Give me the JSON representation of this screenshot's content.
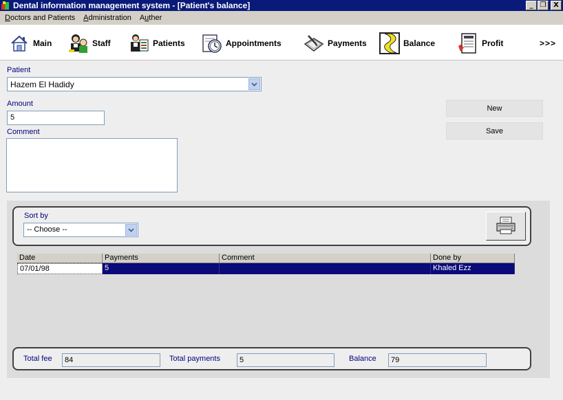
{
  "window": {
    "title": "Dental information management system - [Patient's balance]",
    "minimize": "_",
    "restore": "❐",
    "close": "X"
  },
  "menu": {
    "items": [
      {
        "label": "Doctors and Patients",
        "hotkey": "D",
        "rest": "octors and Patients"
      },
      {
        "label": "Administration",
        "hotkey": "A",
        "rest": "dministration"
      },
      {
        "label": "Auther",
        "hotkey": "u",
        "pre": "A",
        "rest": "ther"
      }
    ]
  },
  "toolbar": {
    "items": [
      {
        "label": "Main",
        "icon": "house-icon"
      },
      {
        "label": "Staff",
        "icon": "staff-icon"
      },
      {
        "label": "Patients",
        "icon": "patients-icon"
      },
      {
        "label": "Appointments",
        "icon": "clock-icon"
      },
      {
        "label": "Payments",
        "icon": "payments-icon"
      },
      {
        "label": "Balance",
        "icon": "balance-icon"
      },
      {
        "label": "Profit",
        "icon": "profit-icon"
      }
    ],
    "more": ">>>"
  },
  "form": {
    "patient_label": "Patient",
    "patient_value": "Hazem El Hadidy",
    "amount_label": "Amount",
    "amount_value": "5",
    "comment_label": "Comment",
    "comment_value": "",
    "new_button": "New",
    "save_button": "Save"
  },
  "sort": {
    "label": "Sort by",
    "value": "-- Choose --"
  },
  "grid": {
    "columns": [
      "Date",
      "Payments",
      "Comment",
      "Done by"
    ],
    "rows": [
      {
        "date": "07/01/98",
        "payments": "5",
        "comment": "",
        "done_by": "Khaled Ezz"
      }
    ]
  },
  "totals": {
    "total_fee_label": "Total fee",
    "total_fee_value": "84",
    "total_payments_label": "Total payments",
    "total_payments_value": "5",
    "balance_label": "Balance",
    "balance_value": "79"
  },
  "colors": {
    "titlebar": "#0a1a7a",
    "label": "#000080",
    "selected_row": "#0a0a7a"
  }
}
